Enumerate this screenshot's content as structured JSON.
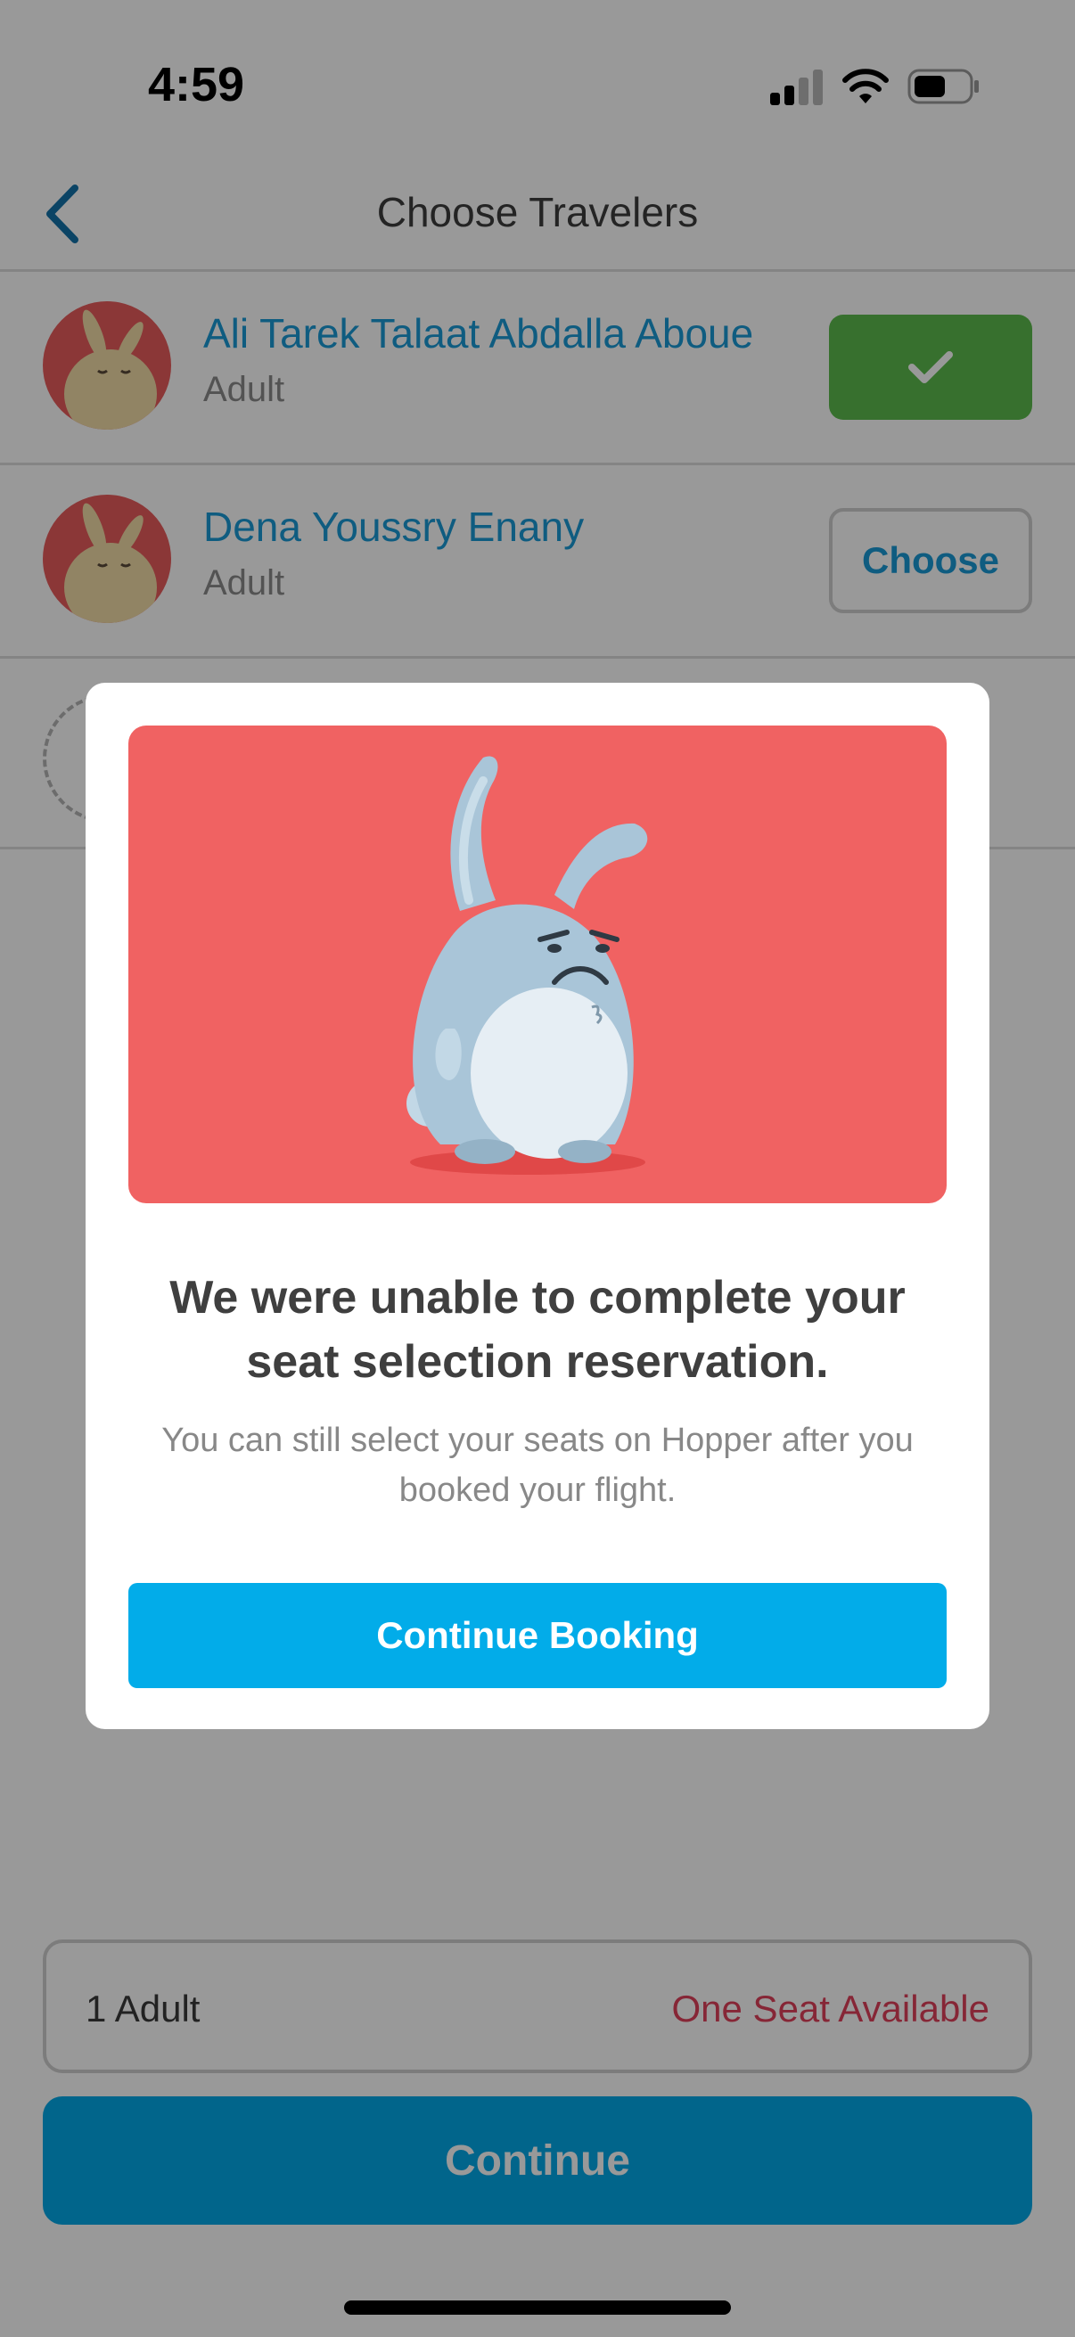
{
  "status_bar": {
    "time": "4:59"
  },
  "nav": {
    "title": "Choose Travelers"
  },
  "travelers": [
    {
      "name": "Ali Tarek Talaat Abdalla Aboue",
      "type": "Adult",
      "selected": true
    },
    {
      "name": "Dena Youssry Enany",
      "type": "Adult",
      "selected": false,
      "action_label": "Choose"
    }
  ],
  "summary": {
    "adults": "1 Adult",
    "availability": "One Seat Available"
  },
  "footer": {
    "continue_label": "Continue"
  },
  "modal": {
    "title": "We were unable to complete your seat selection reservation.",
    "message": "You can still select your seats on Hopper after you booked your flight.",
    "button_label": "Continue Booking"
  },
  "colors": {
    "accent_blue": "#02a9e8",
    "link_blue": "#1a9ad6",
    "selected_green": "#5dbb4e",
    "availability_red": "#e0405a",
    "illustration_red": "#f06262"
  },
  "icons": {
    "back": "chevron-left-icon",
    "selected": "checkmark-icon",
    "signal": "cellular-signal-icon",
    "wifi": "wifi-icon",
    "battery": "battery-icon"
  }
}
